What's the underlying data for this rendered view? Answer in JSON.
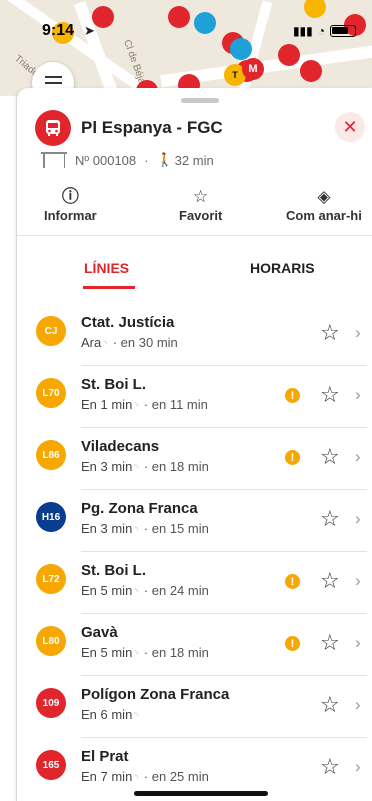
{
  "status_bar": {
    "time": "9:14"
  },
  "map": {
    "street_label_1": "Cl de Béjar",
    "street_label_2": "Triador",
    "pin_labels": [
      "T",
      "M"
    ]
  },
  "stop": {
    "name": "Pl Espanya - FGC",
    "number": "Nº 000108",
    "separator": "·",
    "walk_time": "32 min"
  },
  "actions": {
    "report": "Informar",
    "favorite": "Favorit",
    "directions": "Com anar-hi"
  },
  "tabs": {
    "lines": "LÍNIES",
    "schedules": "HORARIS"
  },
  "lines": [
    {
      "code": "CJ",
      "color": "#f6a800",
      "destination": "Ctat. Justícia",
      "first": "Ara",
      "next": "en 30 min",
      "warning": false
    },
    {
      "code": "L70",
      "color": "#f6a800",
      "destination": "St. Boi L.",
      "first": "En 1 min",
      "next": "en 11 min",
      "warning": true
    },
    {
      "code": "L86",
      "color": "#f6a800",
      "destination": "Viladecans",
      "first": "En 3 min",
      "next": "en 18 min",
      "warning": true
    },
    {
      "code": "H16",
      "color": "#0a3d8f",
      "destination": "Pg. Zona Franca",
      "first": "En 3 min",
      "next": "en 15 min",
      "warning": false
    },
    {
      "code": "L72",
      "color": "#f6a800",
      "destination": "St. Boi L.",
      "first": "En 5 min",
      "next": "en 24 min",
      "warning": true
    },
    {
      "code": "L80",
      "color": "#f6a800",
      "destination": "Gavà",
      "first": "En 5 min",
      "next": "en 18 min",
      "warning": true
    },
    {
      "code": "109",
      "color": "#e0262c",
      "destination": "Polígon Zona Franca",
      "first": "En 6 min",
      "next": "",
      "warning": false
    },
    {
      "code": "165",
      "color": "#e0262c",
      "destination": "El Prat",
      "first": "En 7 min",
      "next": "en 25 min",
      "warning": false
    }
  ]
}
